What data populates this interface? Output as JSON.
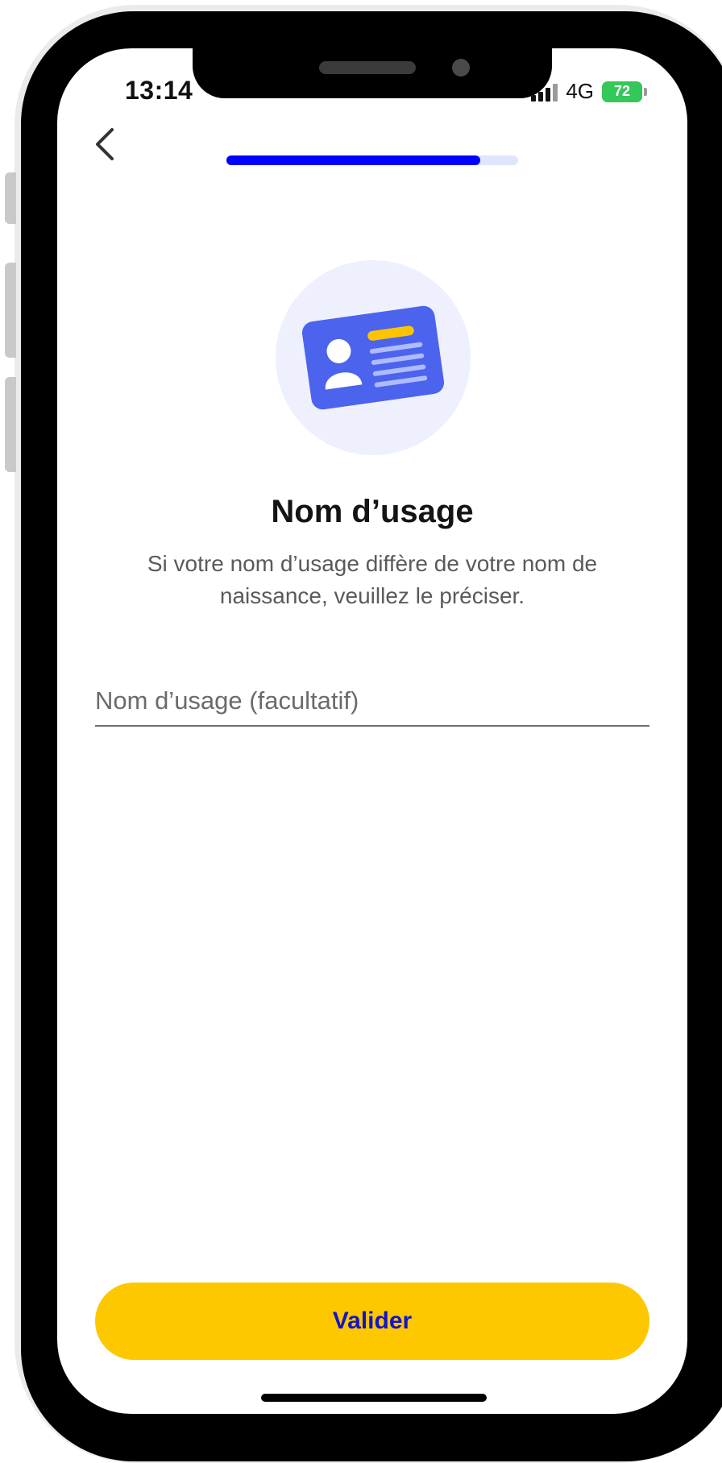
{
  "status_bar": {
    "time": "13:14",
    "network": "4G",
    "battery_level": "72"
  },
  "header": {
    "back_icon": "chevron-left-icon",
    "progress_percent": 87
  },
  "hero": {
    "icon": "id-card-icon"
  },
  "content": {
    "title": "Nom d’usage",
    "subtitle": "Si votre nom d’usage diffère de votre nom de naissance, veuillez le préciser."
  },
  "form": {
    "usage_name_placeholder": "Nom d’usage (facultatif)",
    "usage_name_value": ""
  },
  "actions": {
    "submit_label": "Valider"
  },
  "colors": {
    "accent": "#0000FF",
    "progress_track": "#DFE5FB",
    "button": "#FDC800",
    "button_text": "#1414C8",
    "card": "#4C63EE",
    "card_highlight": "#FFC400",
    "hero_background": "#EEF0FE",
    "battery": "#34C759"
  }
}
